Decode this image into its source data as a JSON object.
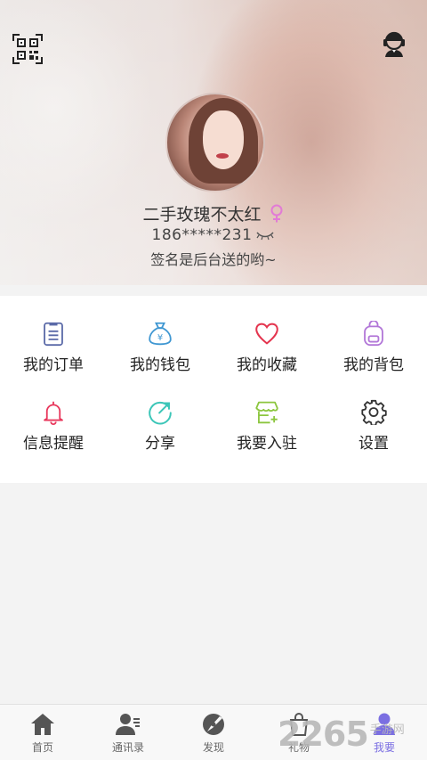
{
  "profile": {
    "nickname": "二手玫瑰不太红",
    "phone": "186*****231",
    "signature": "签名是后台送的哟~",
    "gender_icon": "female-icon",
    "gender_color": "#e27bd6"
  },
  "header": {
    "qr_icon": "qr-code-icon",
    "service_icon": "customer-service-icon"
  },
  "menu": {
    "items": [
      {
        "label": "我的订单",
        "icon": "order-list-icon",
        "color": "#5b6aa8"
      },
      {
        "label": "我的钱包",
        "icon": "money-bag-icon",
        "color": "#3f97d2"
      },
      {
        "label": "我的收藏",
        "icon": "heart-icon",
        "color": "#e4344e"
      },
      {
        "label": "我的背包",
        "icon": "backpack-icon",
        "color": "#b277d8"
      },
      {
        "label": "信息提醒",
        "icon": "bell-icon",
        "color": "#e8365b"
      },
      {
        "label": "分享",
        "icon": "share-icon",
        "color": "#3cc6b8"
      },
      {
        "label": "我要入驻",
        "icon": "store-icon",
        "color": "#8cc63f"
      },
      {
        "label": "设置",
        "icon": "gear-icon",
        "color": "#333333"
      }
    ]
  },
  "tabbar": {
    "items": [
      {
        "label": "首页",
        "icon": "home-icon"
      },
      {
        "label": "通讯录",
        "icon": "contacts-icon"
      },
      {
        "label": "发现",
        "icon": "discover-icon"
      },
      {
        "label": "礼物",
        "icon": "gift-icon"
      },
      {
        "label": "我要",
        "icon": "profile-icon",
        "active": true
      }
    ],
    "active_color": "#7b6fe2"
  },
  "watermark": {
    "number": "2265",
    "text": "手游网"
  }
}
